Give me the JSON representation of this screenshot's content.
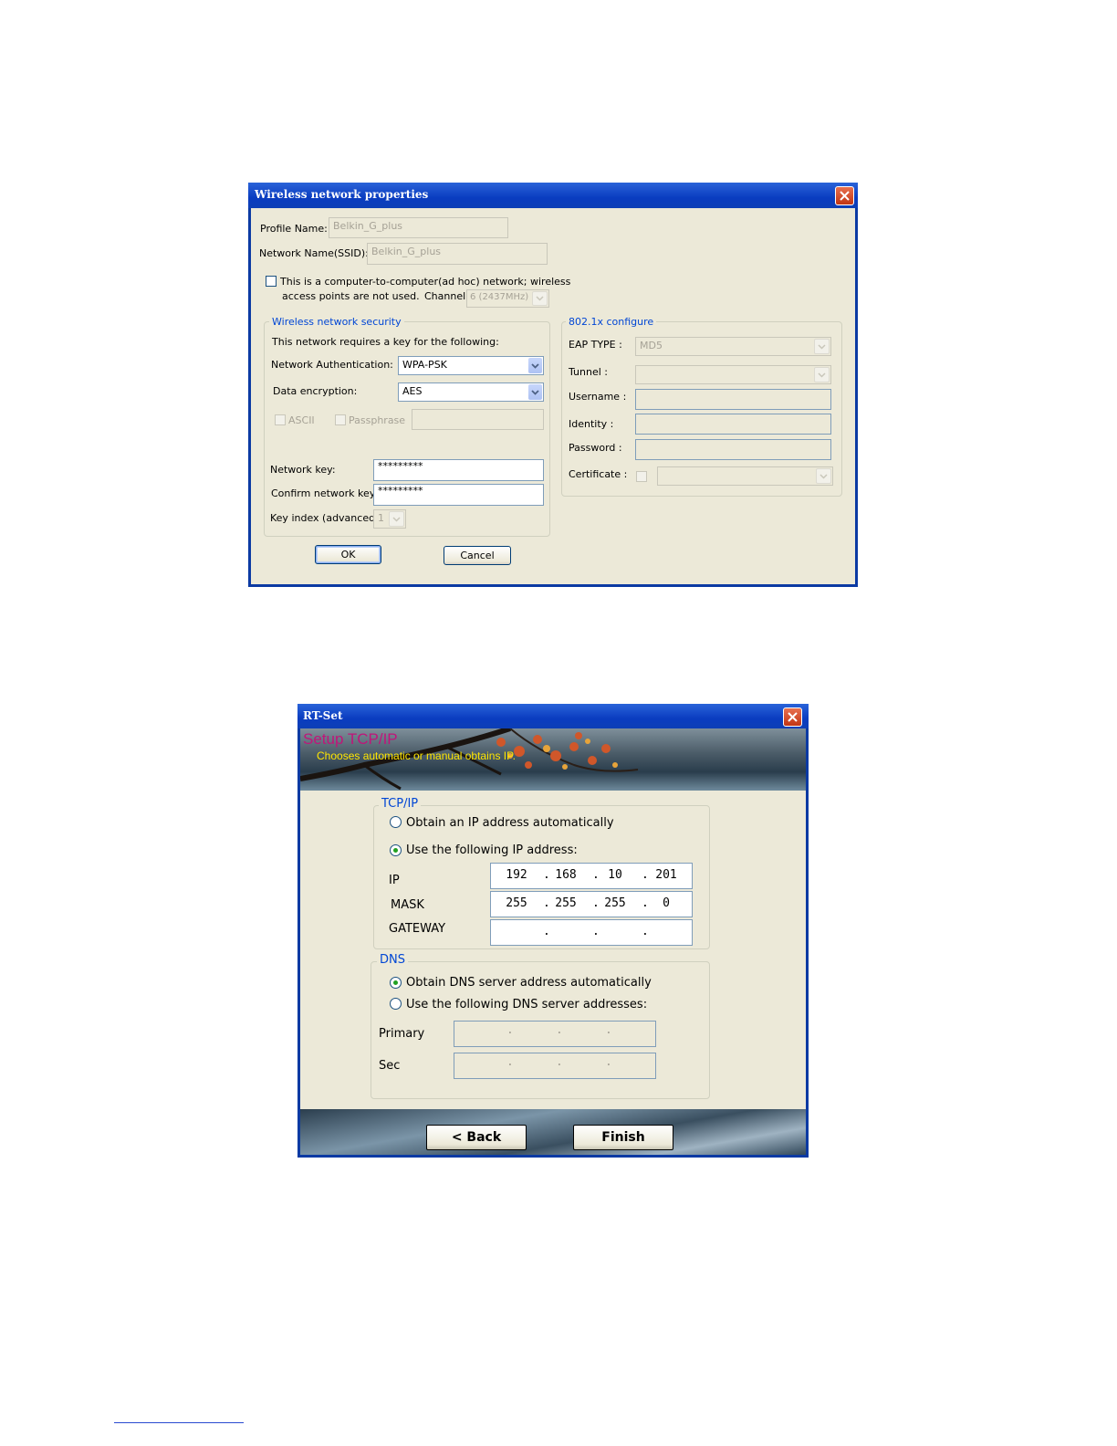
{
  "dialog1": {
    "title": "Wireless network properties",
    "profile_name_label": "Profile Name:",
    "profile_name_value": "Belkin_G_plus",
    "ssid_label": "Network Name(SSID):",
    "ssid_value": "Belkin_G_plus",
    "adhoc_line1": "This is a computer-to-computer(ad hoc) network; wireless",
    "adhoc_line2": "access points are not used.",
    "channel_label": "Channel",
    "channel_value": "6 (2437MHz)",
    "security_group_title": "Wireless network security",
    "security_note": "This network requires a key for the following:",
    "auth_label": "Network Authentication:",
    "auth_value": "WPA-PSK",
    "encryption_label": "Data encryption:",
    "encryption_value": "AES",
    "ascii_label": "ASCII",
    "passphrase_label": "Passphrase",
    "network_key_label": "Network key:",
    "network_key_value": "*********",
    "confirm_key_label": "Confirm network key:",
    "confirm_key_value": "*********",
    "key_index_label": "Key index (advanced):",
    "key_index_value": "1",
    "dot1x_group_title": "802.1x configure",
    "eap_type_label": "EAP TYPE :",
    "eap_type_value": "MD5",
    "tunnel_label": "Tunnel :",
    "username_label": "Username :",
    "identity_label": "Identity :",
    "password_label": "Password :",
    "certificate_label": "Certificate :",
    "ok_label": "OK",
    "cancel_label": "Cancel"
  },
  "dialog2": {
    "title": "RT-Set",
    "banner_title": "Setup TCP/IP",
    "banner_subtitle": "Chooses automatic or manual obtains IP.",
    "tcpip_group_title": "TCP/IP",
    "obtain_ip_auto": "Obtain an IP address automatically",
    "use_following_ip": "Use the following IP address:",
    "ip_label": "IP",
    "ip": [
      "192",
      "168",
      "10",
      "201"
    ],
    "mask_label": "MASK",
    "mask": [
      "255",
      "255",
      "255",
      "0"
    ],
    "gateway_label": "GATEWAY",
    "dns_group_title": "DNS",
    "obtain_dns_auto": "Obtain DNS server address automatically",
    "use_following_dns": "Use the following DNS server addresses:",
    "primary_label": "Primary",
    "sec_label": "Sec",
    "back_label": "< Back",
    "finish_label": "Finish"
  }
}
